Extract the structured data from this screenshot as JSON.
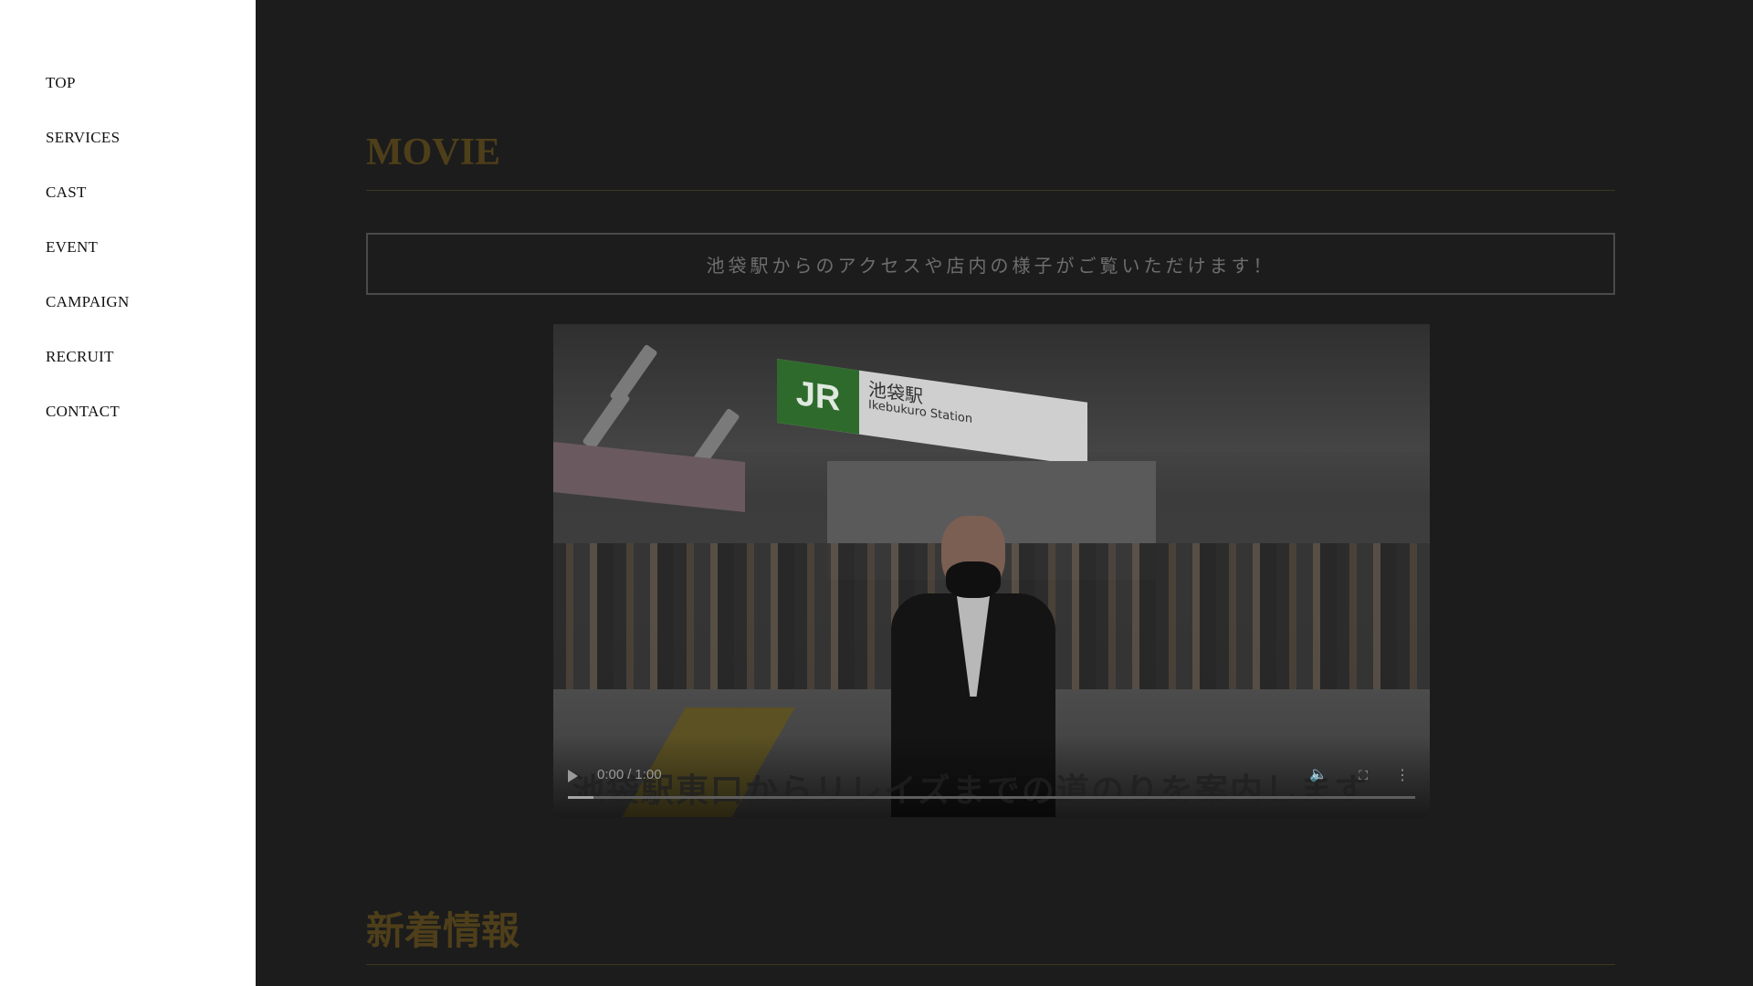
{
  "nav": {
    "items": [
      {
        "label": "TOP"
      },
      {
        "label": "SERVICES"
      },
      {
        "label": "CAST"
      },
      {
        "label": "EVENT"
      },
      {
        "label": "CAMPAIGN"
      },
      {
        "label": "RECRUIT"
      },
      {
        "label": "CONTACT"
      }
    ]
  },
  "movie": {
    "title": "MOVIE",
    "notice": "池袋駅からのアクセスや店内の様子がご覧いただけます！",
    "video": {
      "sign_jr": "JR",
      "sign_station_jp": "池袋駅",
      "sign_station_en": "Ikebukuro Station",
      "subtitle": "池袋駅東口からリレイズまでの道のりを案内します",
      "current_time": "0:00",
      "duration": "1:00",
      "progress": 0.03,
      "icons": {
        "play": "play-icon",
        "volume": "volume-icon",
        "fullscreen": "fullscreen-icon",
        "more": "more-vertical-icon"
      }
    }
  },
  "news": {
    "title": "新着情報"
  },
  "colors": {
    "sidebar_bg": "#ffffff",
    "main_bg": "#1c1c1c",
    "accent_gold": "#4e3f1a",
    "notice_text": "#6e6e6e"
  }
}
